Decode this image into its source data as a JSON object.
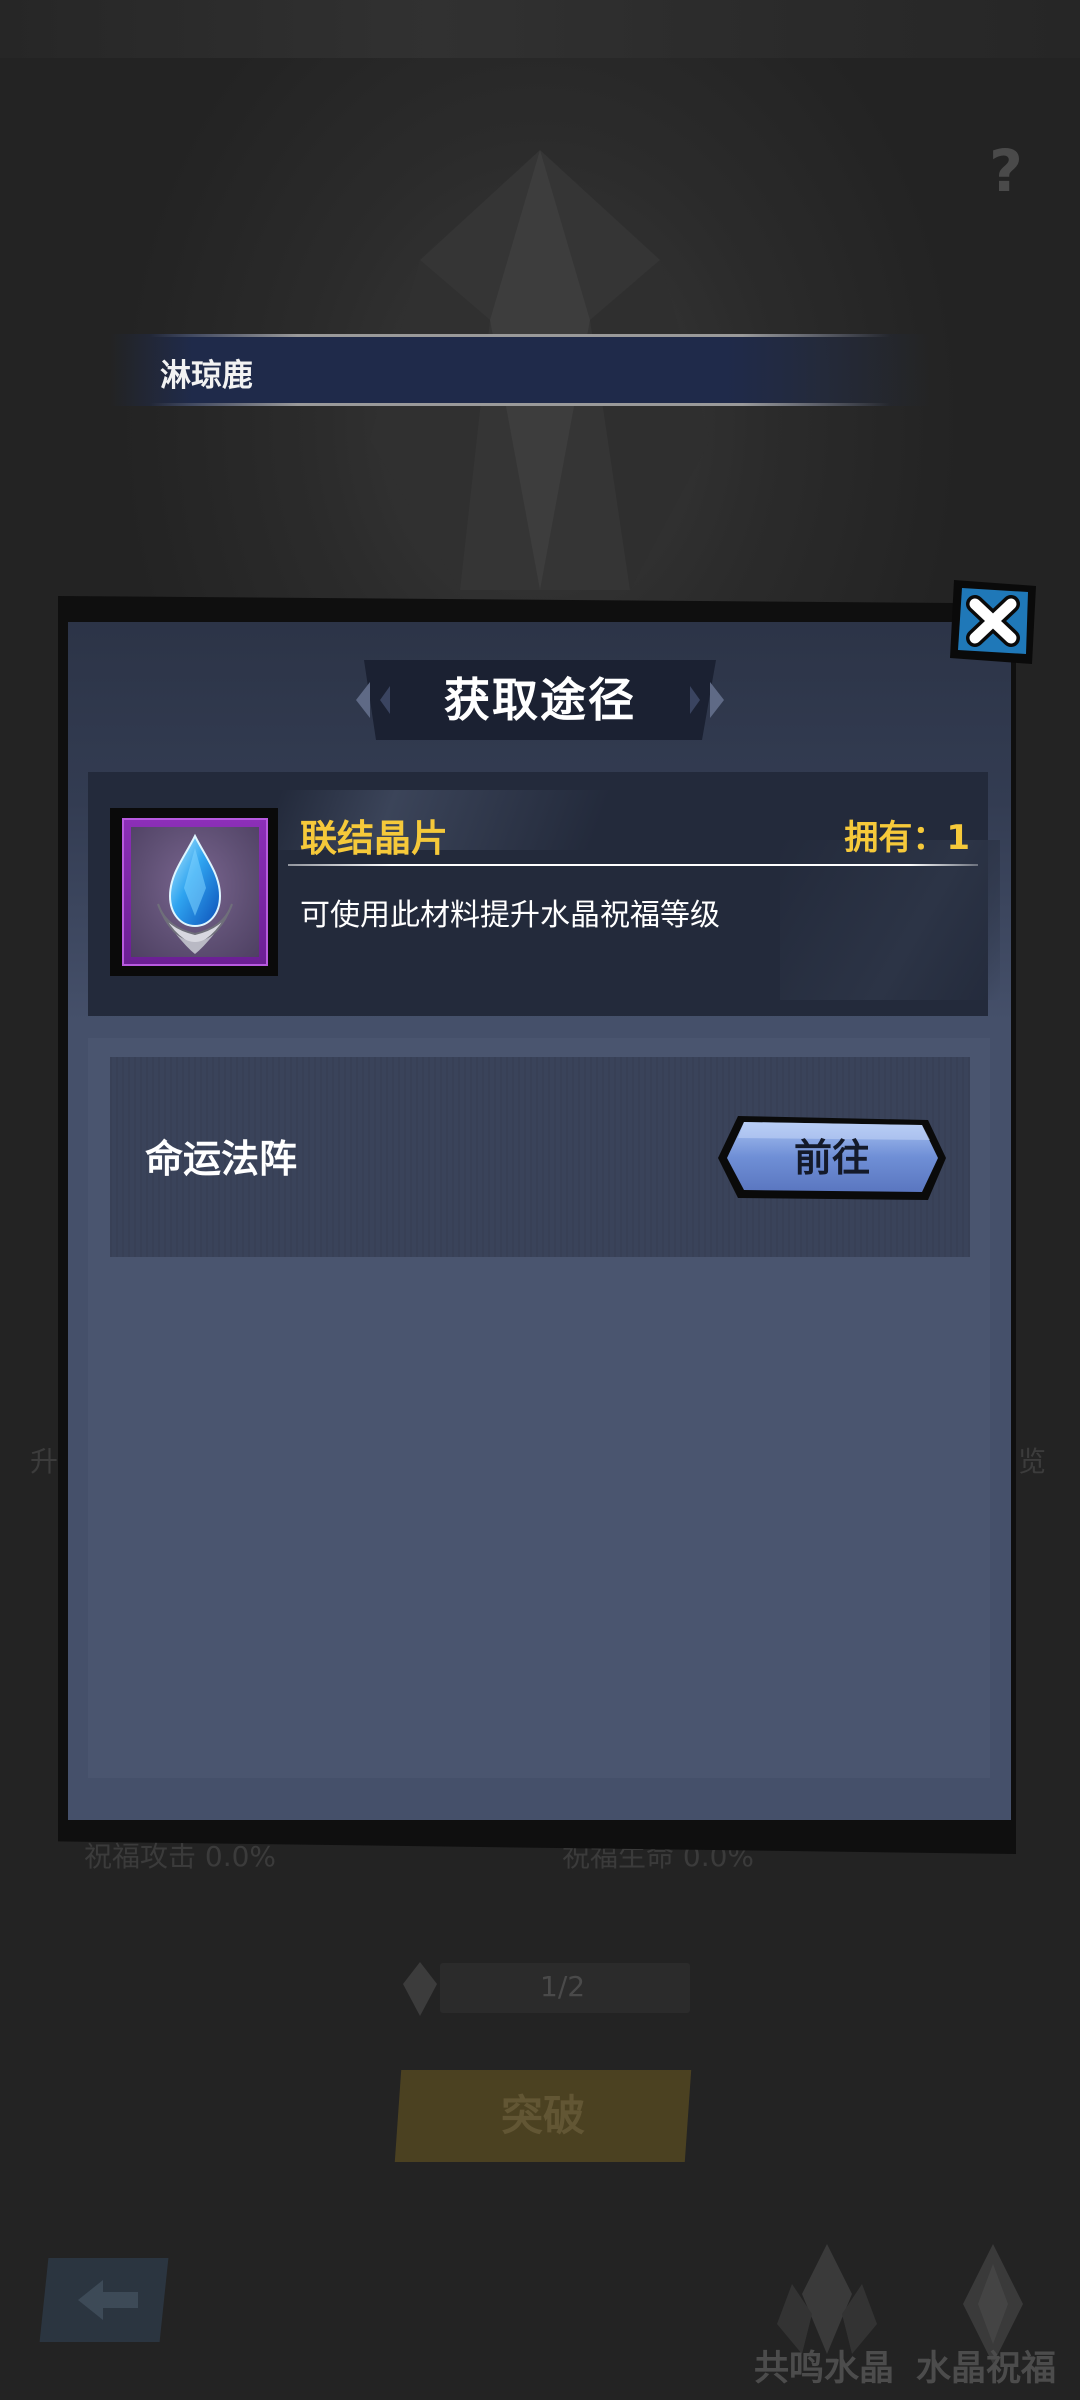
{
  "background": {
    "character_name": "淋琼鹿",
    "help_icon": "question-mark-icon",
    "side_left_text": "升",
    "side_right_text": "览",
    "stat_attack": "祝福攻击 0.0%",
    "stat_hp": "祝福生命 0.0%",
    "progress_text": "1/2",
    "break_button_label": "突破",
    "tabs": [
      {
        "label": "共鸣水晶",
        "icon": "crystal-icon"
      },
      {
        "label": "水晶祝福",
        "icon": "crystal-icon"
      }
    ],
    "back_icon": "back-arrow-icon"
  },
  "dialog": {
    "title": "获取途径",
    "close_icon": "close-icon",
    "item": {
      "name": "联结晶片",
      "owned_text": "拥有：1",
      "description": "可使用此材料提升水晶祝福等级",
      "icon": "crystal-shard-icon"
    },
    "sources": [
      {
        "name": "命运法阵",
        "button_label": "前往"
      }
    ]
  },
  "colors": {
    "accent_gold": "#f6c93a",
    "panel": "#45506a",
    "button_blue": "#6f8fd6",
    "close_blue": "#1f78b8"
  }
}
